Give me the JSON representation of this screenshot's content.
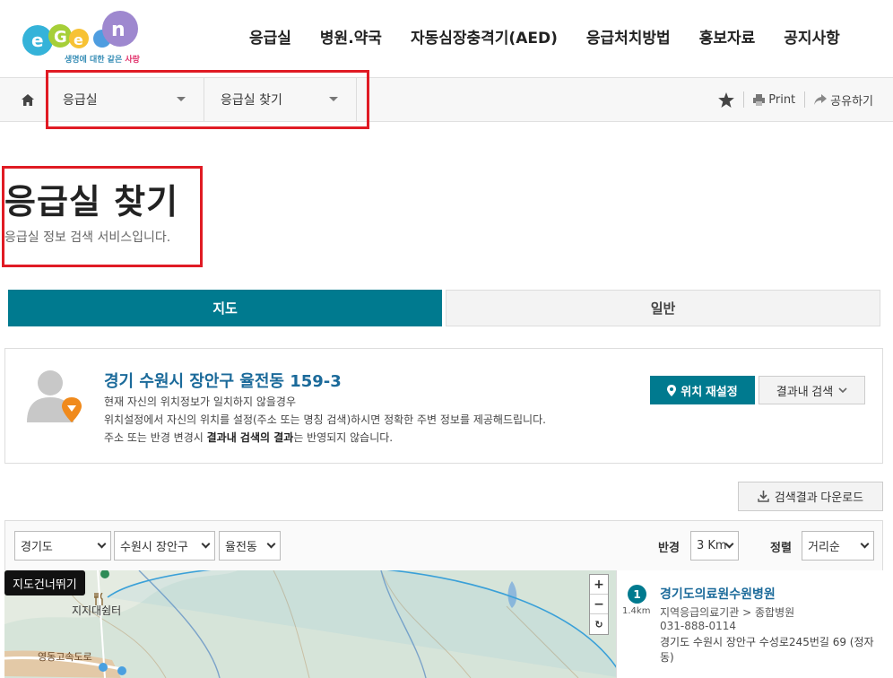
{
  "header": {
    "logo_tagline_a": "생명에 대한 같은",
    "logo_tagline_b": "사랑",
    "nav": [
      "응급실",
      "병원.약국",
      "자동심장충격기(AED)",
      "응급처치방법",
      "홍보자료",
      "공지사항"
    ]
  },
  "breadcrumb": {
    "select1": "응급실",
    "select2": "응급실 찾기",
    "print": "Print",
    "share": "공유하기"
  },
  "page": {
    "title": "응급실 찾기",
    "description": "응급실 정보 검색 서비스입니다."
  },
  "tabs": {
    "map": "지도",
    "general": "일반"
  },
  "location": {
    "address": "경기 수원시 장안구 율전동 159-3",
    "line1": "현재 자신의 위치정보가 일치하지 않을경우",
    "line2": "위치설정에서 자신의 위치를 설정(주소 또는 명칭 검색)하시면 정확한 주변 정보를 제공해드립니다.",
    "line3_pre": "주소 또는 반경 변경시 ",
    "line3_bold": "결과내 검색의 결과",
    "line3_post": "는 반영되지 않습니다.",
    "reset_button": "위치 재설정",
    "insearch_button": "결과내 검색"
  },
  "download_button": "검색결과 다운로드",
  "filters": {
    "province": "경기도",
    "city": "수원시 장안구",
    "dong": "율전동",
    "radius_label": "반경",
    "radius_value": "3 Km",
    "sort_label": "정렬",
    "sort_value": "거리순"
  },
  "map": {
    "skip_button": "지도건너뛰기",
    "label_jiji": "지지대쉼터",
    "label_expressway": "영동고속도로",
    "zoom_in": "+",
    "zoom_out": "−",
    "reset": "↻"
  },
  "results": [
    {
      "num": "1",
      "distance": "1.4km",
      "name": "경기도의료원수원병원",
      "type": "지역응급의료기관 > 종합병원",
      "tel": "031-888-0114",
      "address": "경기도 수원시 장안구 수성로245번길 69 (정자동)"
    }
  ],
  "colors": {
    "primary": "#007a8f",
    "link": "#1b6a9a",
    "highlight_box": "#e01b24"
  }
}
